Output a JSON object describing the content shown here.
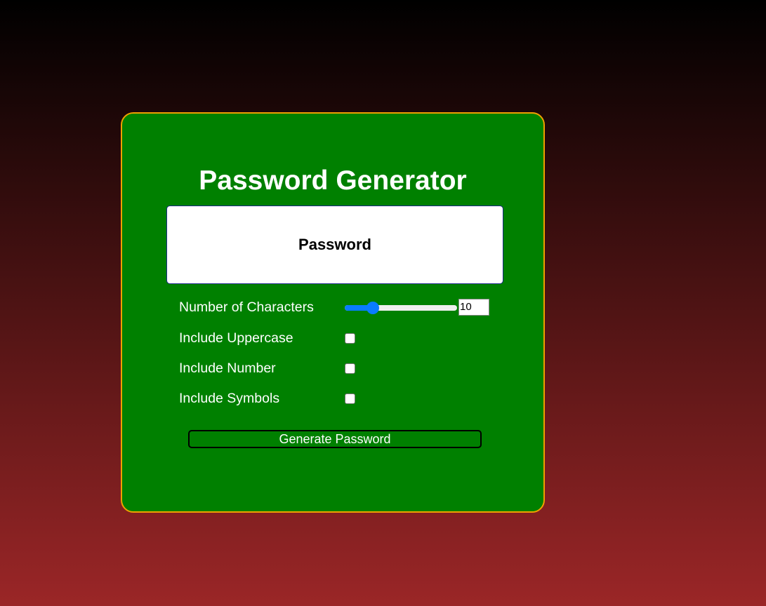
{
  "app": {
    "title": "Password Generator"
  },
  "password_display": {
    "text": "Password"
  },
  "options": {
    "length": {
      "label": "Number of Characters",
      "value": "10",
      "slider_fraction": 0.22
    },
    "uppercase": {
      "label": "Include Uppercase",
      "checked": false
    },
    "number": {
      "label": "Include Number",
      "checked": false
    },
    "symbols": {
      "label": "Include Symbols",
      "checked": false
    }
  },
  "actions": {
    "generate_label": "Generate Password"
  },
  "colors": {
    "card_background": "#008000",
    "card_border": "#f0a000",
    "slider_accent": "#0a7cff",
    "background_top": "#000000",
    "background_bottom": "#9b2627"
  }
}
